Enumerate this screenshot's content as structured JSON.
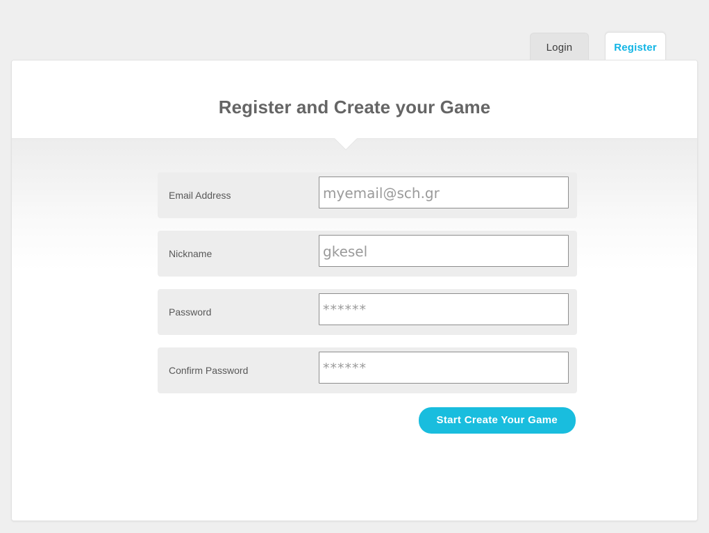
{
  "tabs": [
    {
      "id": "login",
      "label": "Login",
      "active": false
    },
    {
      "id": "register",
      "label": "Register",
      "active": true
    }
  ],
  "header": {
    "title": "Register and Create your Game"
  },
  "form": {
    "rows": [
      {
        "name": "email",
        "label": "Email Address",
        "value": "",
        "placeholder": "myemail@sch.gr",
        "type": "text"
      },
      {
        "name": "nickname",
        "label": "Nickname",
        "value": "",
        "placeholder": "gkesel",
        "type": "text"
      },
      {
        "name": "password",
        "label": "Password",
        "value": "",
        "placeholder": "******",
        "type": "password"
      },
      {
        "name": "confirm-password",
        "label": "Confirm Password",
        "value": "",
        "placeholder": "******",
        "type": "password"
      }
    ],
    "submit_label": "Start Create Your Game"
  },
  "colors": {
    "accent": "#19bdde",
    "page_background": "#efefef",
    "row_background": "#ededed",
    "label_text": "#585858",
    "title_text": "#656565",
    "placeholder_text": "#9a9a9a"
  }
}
